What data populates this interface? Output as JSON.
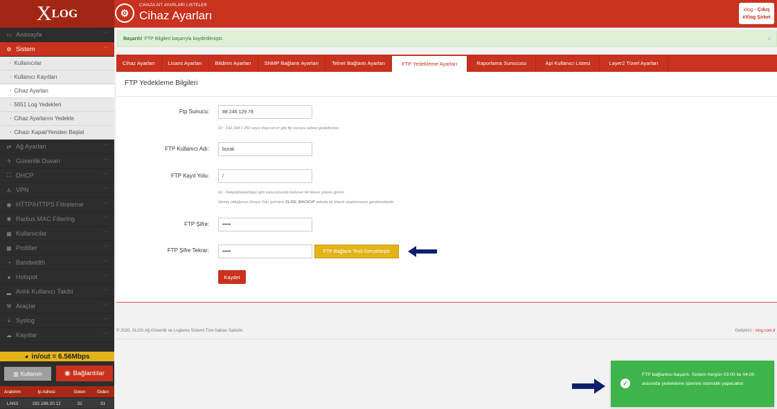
{
  "header": {
    "logo_big": "X",
    "logo_small": "LOG",
    "icon_glyph": "⚙",
    "subtitle": "CIHAZA AIT AYARLARI LISTELER",
    "title": "Cihaz Ayarları",
    "user": "xlog",
    "logout": "Çıkış",
    "company": "#Xlog Şirket"
  },
  "sidebar": {
    "items": [
      {
        "label": "Anasayfa",
        "icon": "▭"
      },
      {
        "label": "Sistem",
        "icon": "⚙"
      },
      {
        "label": "Kullanıcılar"
      },
      {
        "label": "Kullanıcı Kayıtları"
      },
      {
        "label": "Cihaz Ayarları"
      },
      {
        "label": "5651 Log Yedekleri"
      },
      {
        "label": "Cihaz Ayarlarını Yedekle"
      },
      {
        "label": "Cihazı Kapat/Yeniden Başlat"
      },
      {
        "label": "Ağ Ayarları",
        "icon": "⇄"
      },
      {
        "label": "Güvenlik Duvarı",
        "icon": "ϟ"
      },
      {
        "label": "DHCP",
        "icon": "⛶"
      },
      {
        "label": "VPN",
        "icon": "♙"
      },
      {
        "label": "HTTP/HTTPS Filtreleme",
        "icon": "◉"
      },
      {
        "label": "Radius MAC Filtering",
        "icon": "✱"
      },
      {
        "label": "Kullanıcılar",
        "icon": "▦"
      },
      {
        "label": "Profiller",
        "icon": "▦"
      },
      {
        "label": "Bandwidth",
        "icon": "◔"
      },
      {
        "label": "Hotspot",
        "icon": "●"
      },
      {
        "label": "Anlık Kullanıcı Takibi",
        "icon": "▂"
      },
      {
        "label": "Araçlar",
        "icon": "⚒"
      },
      {
        "label": "Syslog",
        "icon": "⤓"
      },
      {
        "label": "Kayıtlar",
        "icon": "☁"
      }
    ],
    "traffic": "in/out = 6.56Mbps",
    "btn_usage": "Kullanım",
    "btn_connections": "Bağlantılar",
    "table": {
      "headers": [
        "Arabirim",
        "Ip Adresi",
        "Gelen",
        "Giden"
      ],
      "row": [
        "LAN3",
        "192.168.20.12",
        "32",
        "31"
      ]
    }
  },
  "alert": {
    "strong": "Başarılı!",
    "text": "FTP Bilgileri başarıyla kaydedilmiştir.",
    "close": "×"
  },
  "tabs": [
    "Cihaz Ayarları",
    "Lisans Ayarları",
    "Bildirim Ayarları",
    "SNMP Bağlantı Ayarları",
    "Telnet Bağlantı Ayarları",
    "FTP Yedekleme Ayarları",
    "Raporlama Sunucusu",
    "Api Kullanıcı Listesi",
    "Layer2 Tünel Ayarları"
  ],
  "form": {
    "title": "FTP Yedekleme Bilgileri",
    "server_label": "Ftp Sunucu:",
    "server_value": "88.246.129.79",
    "server_hint": "Ör : 192.168.1.250 veya xlog.com.tr gibi ftp sunucu adresi girebilirsiniz.",
    "user_label": "FTP Kullanıcı Adı:",
    "user_value": "burak",
    "path_label": "FTP Kayıt Yolu:",
    "path_value": "/",
    "path_hint1": "Ör : /netpub/www/logs/ gibi sunucunuzda bulunan bir klasor yolunu giriniz.",
    "path_hint2_pre": "Girmiş olduğunuz Dosya Yolu içerisine",
    "path_hint2_bold": "XLOG_BACKUP",
    "path_hint2_post": "adında bir klasör oluşturmanız gerekmektedir.",
    "pass_label": "FTP Şifre:",
    "pass_value": "•••••",
    "pass2_label": "FTP Şifre Tekrar:",
    "pass2_value": "•••••",
    "test_button": "FTP Bağlantı Testi Gerçekleştir",
    "save_button": "Kaydet"
  },
  "footer": {
    "left": "© 2020. XLOG Ağ Güvenlik ve Loglama Sistemi Tüm hakları Saklıdır.",
    "right_prefix": "Geliştirici :",
    "right_link": "xlog.com.tr"
  },
  "toast": {
    "check": "✓",
    "message": "FTP bağlantısı başarılı. Sistem hergün 03:00 ile 04:00 arasında yedekleme işlemini otomatik yapacaktır."
  },
  "colors": {
    "brand": "#c8321e",
    "accent": "#e3b31a",
    "success": "#3fb44a",
    "arrow": "#0e1f6e"
  }
}
